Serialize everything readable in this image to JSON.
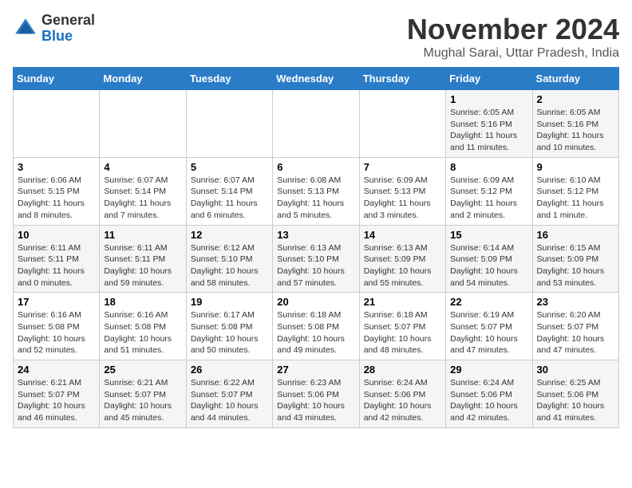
{
  "header": {
    "logo_general": "General",
    "logo_blue": "Blue",
    "month_title": "November 2024",
    "location": "Mughal Sarai, Uttar Pradesh, India"
  },
  "days_of_week": [
    "Sunday",
    "Monday",
    "Tuesday",
    "Wednesday",
    "Thursday",
    "Friday",
    "Saturday"
  ],
  "weeks": [
    [
      {
        "day": "",
        "info": ""
      },
      {
        "day": "",
        "info": ""
      },
      {
        "day": "",
        "info": ""
      },
      {
        "day": "",
        "info": ""
      },
      {
        "day": "",
        "info": ""
      },
      {
        "day": "1",
        "info": "Sunrise: 6:05 AM\nSunset: 5:16 PM\nDaylight: 11 hours and 11 minutes."
      },
      {
        "day": "2",
        "info": "Sunrise: 6:05 AM\nSunset: 5:16 PM\nDaylight: 11 hours and 10 minutes."
      }
    ],
    [
      {
        "day": "3",
        "info": "Sunrise: 6:06 AM\nSunset: 5:15 PM\nDaylight: 11 hours and 8 minutes."
      },
      {
        "day": "4",
        "info": "Sunrise: 6:07 AM\nSunset: 5:14 PM\nDaylight: 11 hours and 7 minutes."
      },
      {
        "day": "5",
        "info": "Sunrise: 6:07 AM\nSunset: 5:14 PM\nDaylight: 11 hours and 6 minutes."
      },
      {
        "day": "6",
        "info": "Sunrise: 6:08 AM\nSunset: 5:13 PM\nDaylight: 11 hours and 5 minutes."
      },
      {
        "day": "7",
        "info": "Sunrise: 6:09 AM\nSunset: 5:13 PM\nDaylight: 11 hours and 3 minutes."
      },
      {
        "day": "8",
        "info": "Sunrise: 6:09 AM\nSunset: 5:12 PM\nDaylight: 11 hours and 2 minutes."
      },
      {
        "day": "9",
        "info": "Sunrise: 6:10 AM\nSunset: 5:12 PM\nDaylight: 11 hours and 1 minute."
      }
    ],
    [
      {
        "day": "10",
        "info": "Sunrise: 6:11 AM\nSunset: 5:11 PM\nDaylight: 11 hours and 0 minutes."
      },
      {
        "day": "11",
        "info": "Sunrise: 6:11 AM\nSunset: 5:11 PM\nDaylight: 10 hours and 59 minutes."
      },
      {
        "day": "12",
        "info": "Sunrise: 6:12 AM\nSunset: 5:10 PM\nDaylight: 10 hours and 58 minutes."
      },
      {
        "day": "13",
        "info": "Sunrise: 6:13 AM\nSunset: 5:10 PM\nDaylight: 10 hours and 57 minutes."
      },
      {
        "day": "14",
        "info": "Sunrise: 6:13 AM\nSunset: 5:09 PM\nDaylight: 10 hours and 55 minutes."
      },
      {
        "day": "15",
        "info": "Sunrise: 6:14 AM\nSunset: 5:09 PM\nDaylight: 10 hours and 54 minutes."
      },
      {
        "day": "16",
        "info": "Sunrise: 6:15 AM\nSunset: 5:09 PM\nDaylight: 10 hours and 53 minutes."
      }
    ],
    [
      {
        "day": "17",
        "info": "Sunrise: 6:16 AM\nSunset: 5:08 PM\nDaylight: 10 hours and 52 minutes."
      },
      {
        "day": "18",
        "info": "Sunrise: 6:16 AM\nSunset: 5:08 PM\nDaylight: 10 hours and 51 minutes."
      },
      {
        "day": "19",
        "info": "Sunrise: 6:17 AM\nSunset: 5:08 PM\nDaylight: 10 hours and 50 minutes."
      },
      {
        "day": "20",
        "info": "Sunrise: 6:18 AM\nSunset: 5:08 PM\nDaylight: 10 hours and 49 minutes."
      },
      {
        "day": "21",
        "info": "Sunrise: 6:18 AM\nSunset: 5:07 PM\nDaylight: 10 hours and 48 minutes."
      },
      {
        "day": "22",
        "info": "Sunrise: 6:19 AM\nSunset: 5:07 PM\nDaylight: 10 hours and 47 minutes."
      },
      {
        "day": "23",
        "info": "Sunrise: 6:20 AM\nSunset: 5:07 PM\nDaylight: 10 hours and 47 minutes."
      }
    ],
    [
      {
        "day": "24",
        "info": "Sunrise: 6:21 AM\nSunset: 5:07 PM\nDaylight: 10 hours and 46 minutes."
      },
      {
        "day": "25",
        "info": "Sunrise: 6:21 AM\nSunset: 5:07 PM\nDaylight: 10 hours and 45 minutes."
      },
      {
        "day": "26",
        "info": "Sunrise: 6:22 AM\nSunset: 5:07 PM\nDaylight: 10 hours and 44 minutes."
      },
      {
        "day": "27",
        "info": "Sunrise: 6:23 AM\nSunset: 5:06 PM\nDaylight: 10 hours and 43 minutes."
      },
      {
        "day": "28",
        "info": "Sunrise: 6:24 AM\nSunset: 5:06 PM\nDaylight: 10 hours and 42 minutes."
      },
      {
        "day": "29",
        "info": "Sunrise: 6:24 AM\nSunset: 5:06 PM\nDaylight: 10 hours and 42 minutes."
      },
      {
        "day": "30",
        "info": "Sunrise: 6:25 AM\nSunset: 5:06 PM\nDaylight: 10 hours and 41 minutes."
      }
    ]
  ]
}
